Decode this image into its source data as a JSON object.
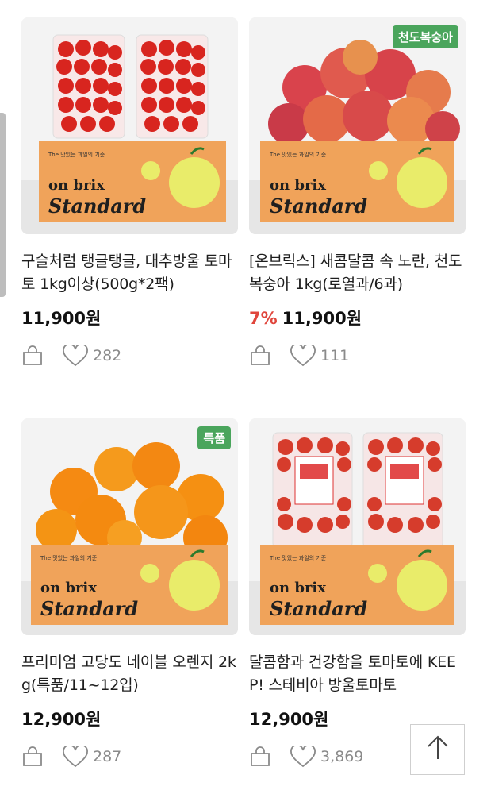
{
  "products": [
    {
      "badge": "",
      "title": "구슬처럼 탱글탱글, 대추방울 토마토 1kg이상(500g*2팩)",
      "discount": "",
      "price": "11,900원",
      "likes": "282",
      "image": "tomatoes-box",
      "box_text": {
        "brand_top": "on brix",
        "brand_bottom": "Standard",
        "tagline": "The 맛있는 과일의 기준"
      }
    },
    {
      "badge": "천도복숭아",
      "title": "[온브릭스] 새콤달콤 속 노란, 천도 복숭아 1kg(로열과/6과)",
      "discount": "7%",
      "price": "11,900원",
      "likes": "111",
      "image": "nectarines-box",
      "box_text": {
        "brand_top": "on brix",
        "brand_bottom": "Standard",
        "tagline": "The 맛있는 과일의 기준"
      }
    },
    {
      "badge": "특품",
      "title": "프리미엄 고당도 네이블 오렌지 2kg(특품/11~12입)",
      "discount": "",
      "price": "12,900원",
      "likes": "287",
      "image": "oranges-box",
      "box_text": {
        "brand_top": "on brix",
        "brand_bottom": "Standard",
        "tagline": "The 맛있는 과일의 기준"
      }
    },
    {
      "badge": "",
      "title": "달콤함과 건강함을 토마토에 KEEP! 스테비아 방울토마토",
      "discount": "",
      "price": "12,900원",
      "likes": "3,869",
      "image": "stevia-tomatoes-box",
      "box_text": {
        "brand_top": "on brix",
        "brand_bottom": "Standard",
        "tagline": "The 맛있는 과일의 기준"
      }
    }
  ],
  "icons": {
    "cart": "shopping-bag-icon",
    "like": "heart-icon",
    "top": "arrow-up-icon"
  },
  "colors": {
    "discount": "#e0463c",
    "badge": "#4aa55c",
    "box": "#f0a35a",
    "apple": "#e9ec6a"
  }
}
